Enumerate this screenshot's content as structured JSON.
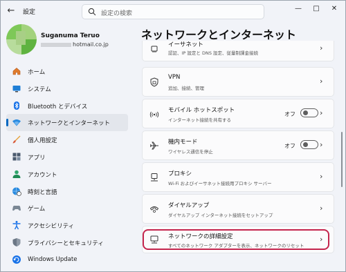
{
  "window": {
    "title": "設定",
    "back_icon": "back-arrow-icon",
    "controls": [
      "minimize-icon",
      "maximize-icon",
      "close-icon"
    ]
  },
  "search": {
    "placeholder": "設定の検索"
  },
  "user": {
    "name": "Suganuma Teruo",
    "email_visible": "hotmail.co.jp"
  },
  "sidebar": {
    "items": [
      {
        "label": "ホーム",
        "icon": "home-icon",
        "selected": false
      },
      {
        "label": "システム",
        "icon": "system-icon",
        "selected": false
      },
      {
        "label": "Bluetooth とデバイス",
        "icon": "bluetooth-icon",
        "selected": false
      },
      {
        "label": "ネットワークとインターネット",
        "icon": "wifi-icon",
        "selected": true
      },
      {
        "label": "個人用設定",
        "icon": "brush-icon",
        "selected": false
      },
      {
        "label": "アプリ",
        "icon": "apps-icon",
        "selected": false
      },
      {
        "label": "アカウント",
        "icon": "account-icon",
        "selected": false
      },
      {
        "label": "時刻と言語",
        "icon": "globe-clock-icon",
        "selected": false
      },
      {
        "label": "ゲーム",
        "icon": "gamepad-icon",
        "selected": false
      },
      {
        "label": "アクセシビリティ",
        "icon": "accessibility-icon",
        "selected": false
      },
      {
        "label": "プライバシーとセキュリティ",
        "icon": "shield-icon",
        "selected": false
      },
      {
        "label": "Windows Update",
        "icon": "update-icon",
        "selected": false
      }
    ]
  },
  "main": {
    "title": "ネットワークとインターネット",
    "cards": [
      {
        "title": "イーサネット",
        "subtitle": "認証、IP 設定と DNS 設定、従量制課金接続",
        "icon": "ethernet-icon"
      },
      {
        "title": "VPN",
        "subtitle": "追加、接続、管理",
        "icon": "vpn-shield-icon"
      },
      {
        "title": "モバイル ホットスポット",
        "subtitle": "インターネット接続を共有する",
        "icon": "hotspot-icon",
        "toggle": "オフ"
      },
      {
        "title": "機内モード",
        "subtitle": "ワイヤレス通信を停止",
        "icon": "airplane-icon",
        "toggle": "オフ"
      },
      {
        "title": "プロキシ",
        "subtitle": "Wi-Fi およびイーサネット接続用プロキシ サーバー",
        "icon": "proxy-icon"
      },
      {
        "title": "ダイヤルアップ",
        "subtitle": "ダイヤルアップ インターネット接続をセットアップ",
        "icon": "dialup-icon"
      },
      {
        "title": "ネットワークの詳細設定",
        "subtitle": "すべてのネットワーク アダプターを表示、ネットワークのリセット",
        "icon": "network-pc-icon",
        "highlighted": true
      }
    ]
  },
  "colors": {
    "accent": "#0067c0",
    "highlight_border": "#c4244c",
    "background": "#f1f3f8",
    "card": "#fbfbfc"
  }
}
